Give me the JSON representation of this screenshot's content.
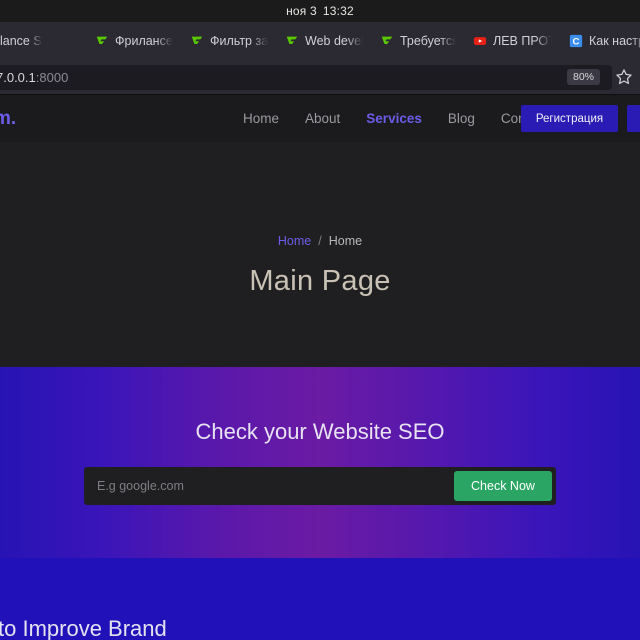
{
  "os": {
    "date": "ноя 3",
    "time": "13:32"
  },
  "browser": {
    "tabs": [
      {
        "title": "lance S",
        "favicon": "none",
        "truncated_left": true
      },
      {
        "title": "Фрилансер",
        "favicon": "freelancer-icon"
      },
      {
        "title": "Фильтр зад",
        "favicon": "freelancer-icon"
      },
      {
        "title": "Web develo",
        "favicon": "freelancer-icon"
      },
      {
        "title": "Требуется",
        "favicon": "freelancer-icon"
      },
      {
        "title": "ЛЕВ ПРОТИ",
        "favicon": "youtube-icon"
      },
      {
        "title": "Как настро",
        "favicon": "c-blue-icon"
      }
    ],
    "url_host": "7.0.0.1",
    "url_port": ":8000",
    "zoom_level": "80%",
    "bookmark_icon": "star-icon"
  },
  "site": {
    "logo": "m.",
    "nav": [
      {
        "label": "Home",
        "active": false
      },
      {
        "label": "About",
        "active": false
      },
      {
        "label": "Services",
        "active": true
      },
      {
        "label": "Blog",
        "active": false
      },
      {
        "label": "Contact",
        "active": false
      }
    ],
    "register_button": "Регистрация",
    "secondary_button": ""
  },
  "hero": {
    "breadcrumb_home_link": "Home",
    "breadcrumb_separator": "/",
    "breadcrumb_current": "Home",
    "title": "Main Page"
  },
  "seo": {
    "title": "Check your Website SEO",
    "input_value": "",
    "input_placeholder": "E.g google.com",
    "button_label": "Check Now"
  },
  "band": {
    "text": "to Improve Brand"
  },
  "colors": {
    "accent_purple": "#6c5ce7",
    "button_blue": "#2a1bb5",
    "button_green": "#2aa564",
    "gradient_blue": "#2713b4",
    "gradient_magenta": "#6b1ba4",
    "band_blue": "#2111b9"
  }
}
